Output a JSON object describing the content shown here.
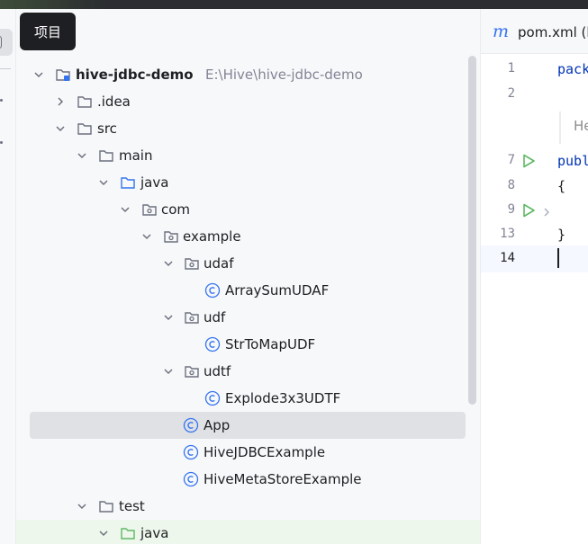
{
  "tooltip": {
    "text": "项目"
  },
  "project_tree": {
    "root": {
      "name": "hive-jdbc-demo",
      "path": "E:\\Hive\\hive-jdbc-demo"
    },
    "items": [
      {
        "label": ".idea",
        "icon": "folder-icon"
      },
      {
        "label": "src",
        "icon": "folder-icon"
      },
      {
        "label": "main",
        "icon": "folder-icon"
      },
      {
        "label": "java",
        "icon": "source-folder-icon"
      },
      {
        "label": "com",
        "icon": "package-icon"
      },
      {
        "label": "example",
        "icon": "package-icon"
      },
      {
        "label": "udaf",
        "icon": "package-icon"
      },
      {
        "label": "ArraySumUDAF",
        "icon": "class-icon"
      },
      {
        "label": "udf",
        "icon": "package-icon"
      },
      {
        "label": "StrToMapUDF",
        "icon": "class-icon"
      },
      {
        "label": "udtf",
        "icon": "package-icon"
      },
      {
        "label": "Explode3x3UDTF",
        "icon": "class-icon"
      },
      {
        "label": "App",
        "icon": "class-icon"
      },
      {
        "label": "HiveJDBCExample",
        "icon": "class-icon"
      },
      {
        "label": "HiveMetaStoreExample",
        "icon": "class-icon"
      },
      {
        "label": "test",
        "icon": "folder-icon"
      },
      {
        "label": "java",
        "icon": "test-folder-icon"
      }
    ]
  },
  "editor": {
    "tab": {
      "icon": "maven-icon",
      "icon_glyph": "m",
      "label": "pom.xml (h"
    },
    "lines": [
      {
        "num": "1",
        "code": "pack"
      },
      {
        "num": "2",
        "code": ""
      },
      {
        "num": "7",
        "code": "publ"
      },
      {
        "num": "8",
        "code": "{"
      },
      {
        "num": "9",
        "code": ""
      },
      {
        "num": "13",
        "code": "}"
      },
      {
        "num": "14",
        "code": ""
      }
    ],
    "hint": "He"
  },
  "colors": {
    "accent": "#3574f0",
    "selection": "#dfe1e5",
    "run_green": "#5fb865",
    "test_row": "#edf7ec",
    "keyword": "#0033b3"
  }
}
